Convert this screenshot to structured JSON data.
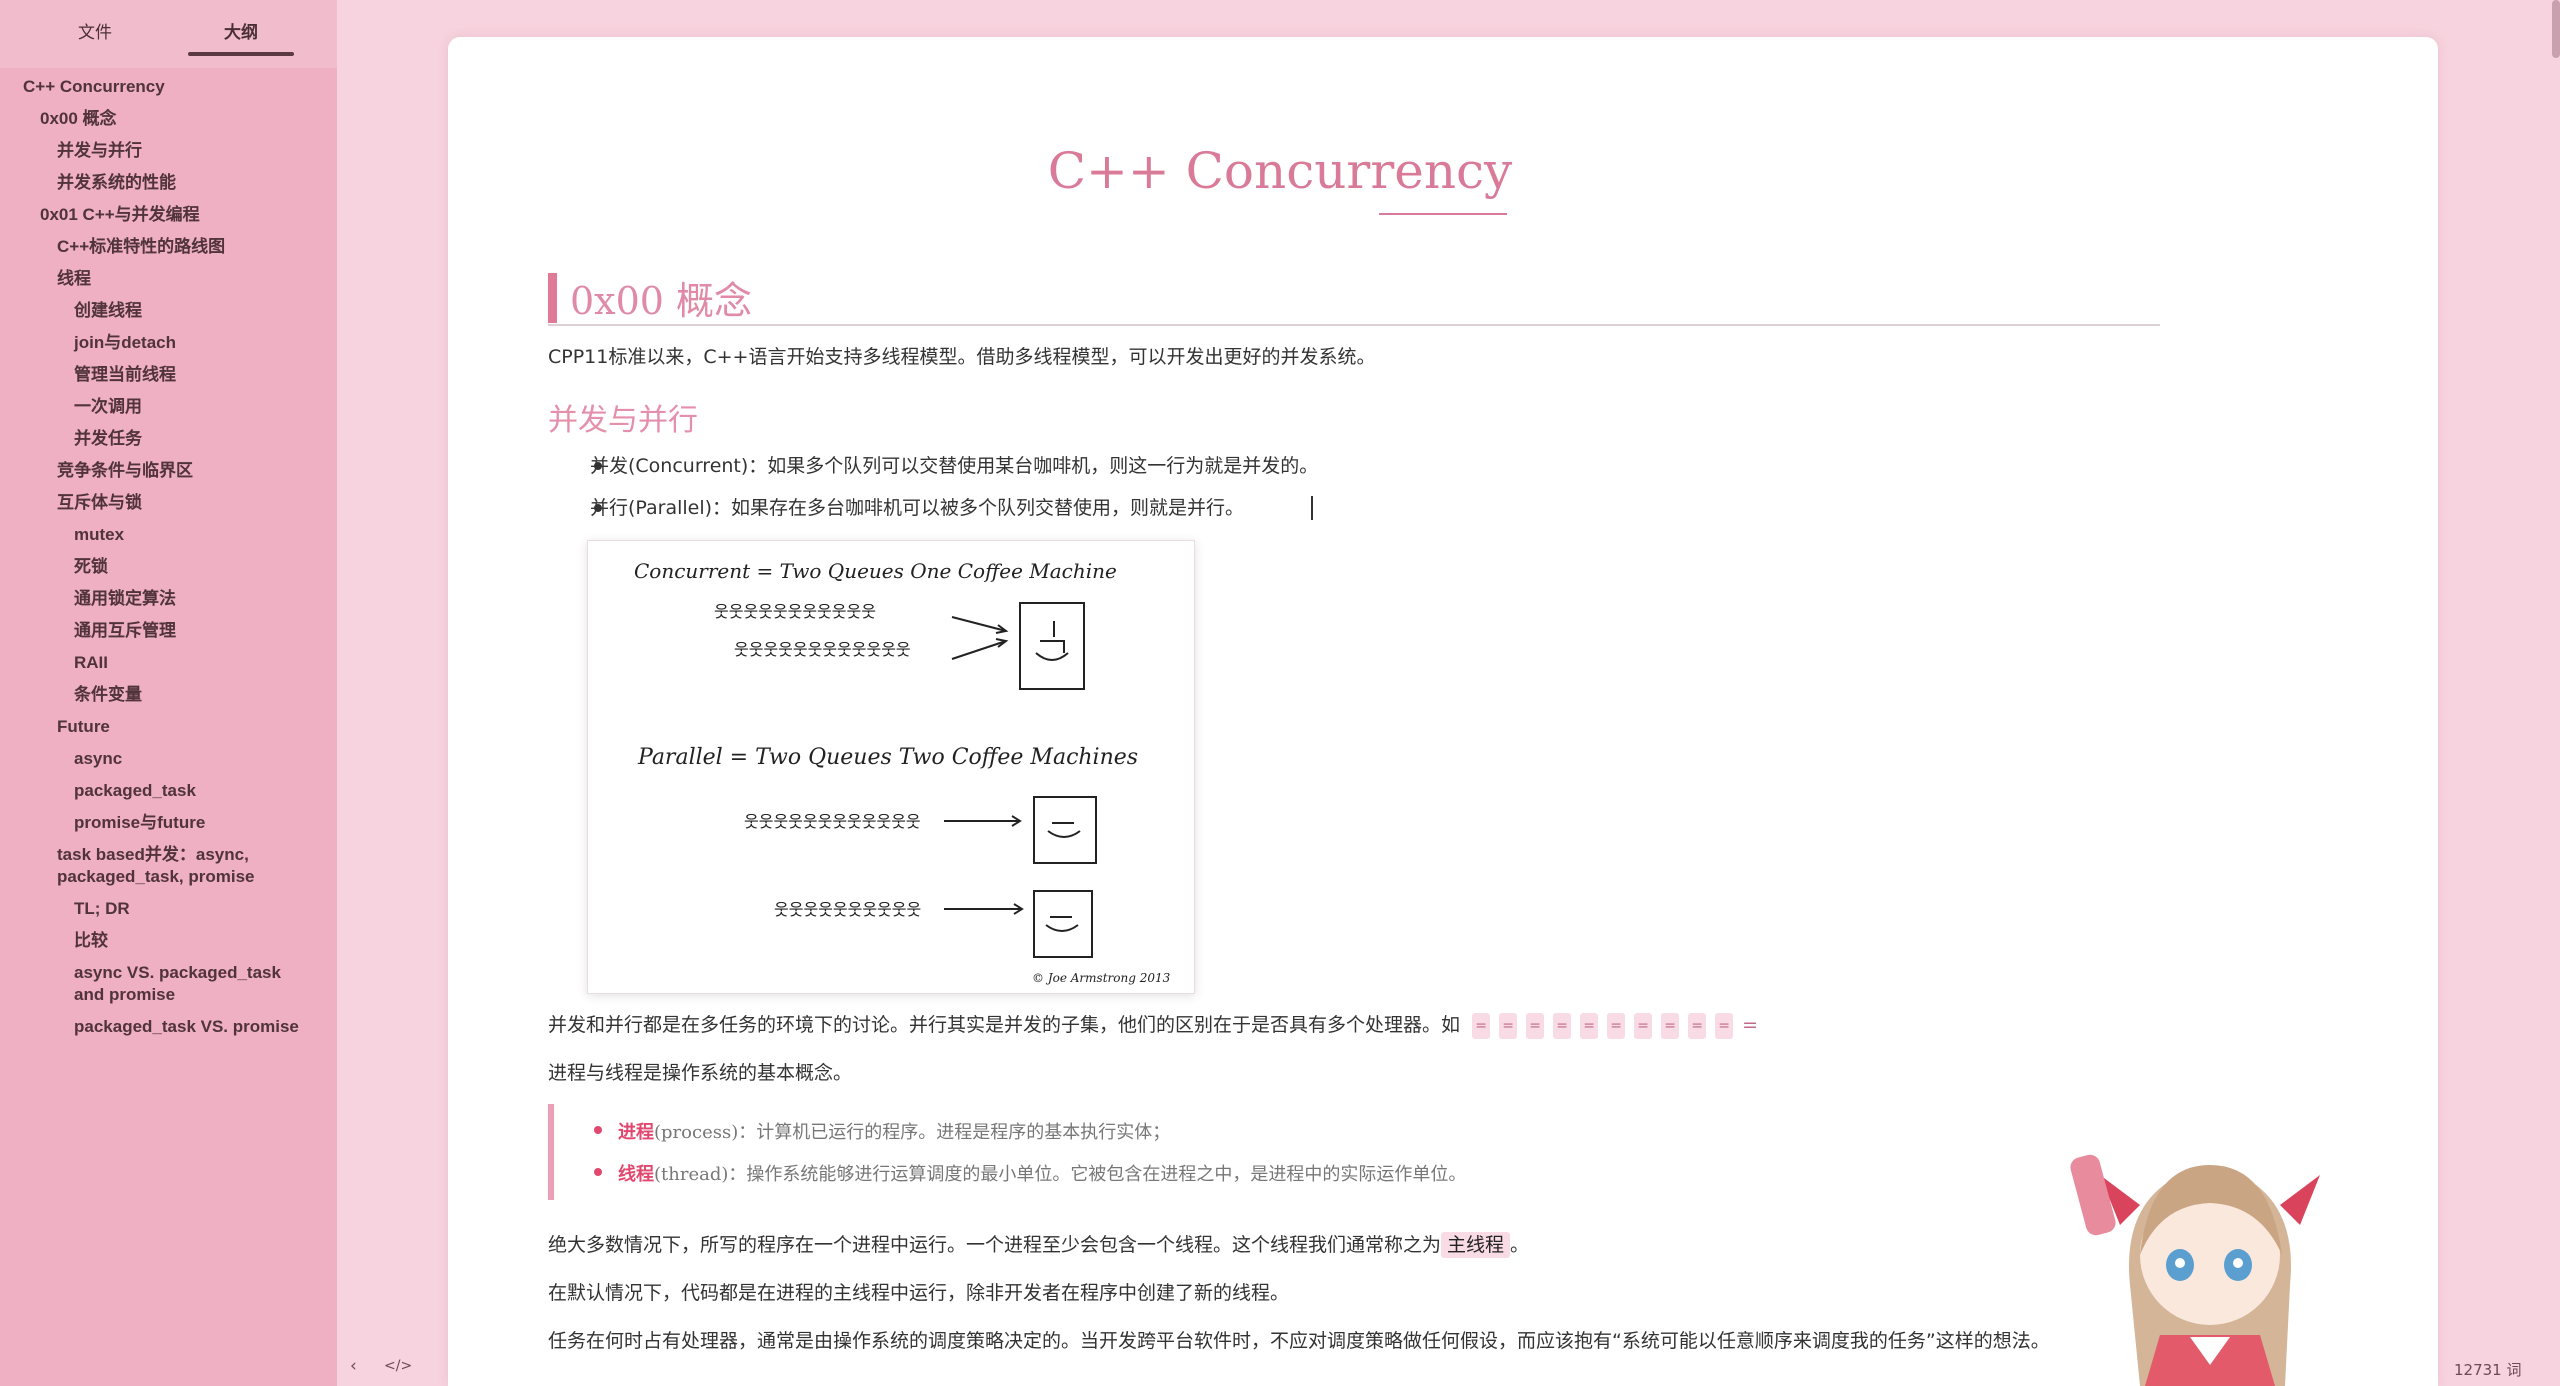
{
  "sidebar": {
    "tabs": {
      "files": "文件",
      "outline": "大纲"
    },
    "outline": [
      {
        "label": "C++ Concurrency"
      },
      {
        "label": "0x00 概念"
      },
      {
        "label": "并发与并行"
      },
      {
        "label": "并发系统的性能"
      },
      {
        "label": "0x01 C++与并发编程"
      },
      {
        "label": "C++标准特性的路线图"
      },
      {
        "label": "线程"
      },
      {
        "label": "创建线程"
      },
      {
        "label": "join与detach"
      },
      {
        "label": "管理当前线程"
      },
      {
        "label": "一次调用"
      },
      {
        "label": "并发任务"
      },
      {
        "label": "竞争条件与临界区"
      },
      {
        "label": "互斥体与锁"
      },
      {
        "label": "mutex"
      },
      {
        "label": "死锁"
      },
      {
        "label": "通用锁定算法"
      },
      {
        "label": "通用互斥管理"
      },
      {
        "label": "RAII"
      },
      {
        "label": "条件变量"
      },
      {
        "label": "Future"
      },
      {
        "label": "async"
      },
      {
        "label": "packaged_task"
      },
      {
        "label": "promise与future"
      },
      {
        "label": "task based并发：async, packaged_task, promise"
      },
      {
        "label": "TL; DR"
      },
      {
        "label": "比较"
      },
      {
        "label": "async VS. packaged_task and promise"
      },
      {
        "label": "packaged_task VS. promise"
      }
    ],
    "footer": {
      "collapse_icon": "‹",
      "source_icon": "</>"
    }
  },
  "document": {
    "title": "C++ Concurrency",
    "h2_gainian": "0x00 概念",
    "p_intro": "CPP11标准以来，C++语言开始支持多线程模型。借助多线程模型，可以开发出更好的并发系统。",
    "h3_binfa": "并发与并行",
    "bullets": [
      "并发(Concurrent)：如果多个队列可以交替使用某台咖啡机，则这一行为就是并发的。",
      "并行(Parallel)：如果存在多台咖啡机可以被多个队列交替使用，则就是并行。"
    ],
    "image": {
      "concurrent_caption": "Concurrent = Two Queues One Coffee Machine",
      "parallel_caption": "Parallel = Two Queues Two Coffee Machines",
      "credit": "© Joe Armstrong 2013"
    },
    "p_compare": "并发和并行都是在多任务的环境下的讨论。并行其实是并发的子集，他们的区别在于是否具有多个处理器。如",
    "eq_chip": "=",
    "eq_tail": "=",
    "p_process_thread": "进程与线程是操作系统的基本概念。",
    "quote": [
      {
        "key": "进程",
        "rest": "(process)：计算机已运行的程序。进程是程序的基本执行实体；"
      },
      {
        "key": "线程",
        "rest": "(thread)：操作系统能够进行运算调度的最小单位。它被包含在进程之中，是进程中的实际运作单位。"
      }
    ],
    "p_main_before": "绝大多数情况下，所写的程序在一个进程中运行。一个进程至少会包含一个线程。这个线程我们通常称之为",
    "p_main_code": "主线程",
    "p_main_after": "。",
    "p_default": "在默认情况下，代码都是在进程的主线程中运行，除非开发者在程序中创建了新的线程。",
    "p_schedule": "任务在何时占有处理器，通常是由操作系统的调度策略决定的。当开发跨平台软件时，不应对调度策略做任何假设，而应该抱有“系统可能以任意顺序来调度我的任务”这样的想法。"
  },
  "status": {
    "word_count": "12731 词"
  },
  "colors": {
    "accent": "#d97a98",
    "sidebar_bg": "#eeb0c2",
    "page_bg": "#f6d3de"
  }
}
